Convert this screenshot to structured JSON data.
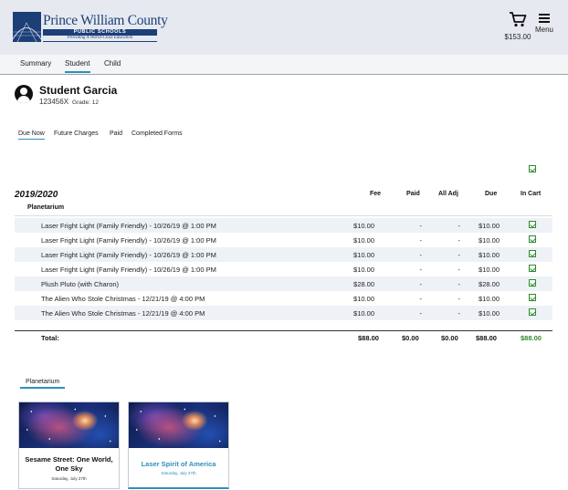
{
  "brand": {
    "name": "Prince William County",
    "band": "PUBLIC SCHOOLS",
    "tagline": "Providing A World-Class Education"
  },
  "header": {
    "cart_amount": "$153.00",
    "menu_label": "Menu"
  },
  "topnav": [
    "Summary",
    "Student",
    "Child"
  ],
  "topnav_active": "Student",
  "student": {
    "name": "Student Garcia",
    "id": "123456X",
    "grade": "Grade: 12"
  },
  "subtabs": [
    "Due Now",
    "Future Charges",
    "Paid",
    "Completed Forms"
  ],
  "subtabs_active": "Due Now",
  "table": {
    "year": "2019/2020",
    "columns": [
      "Fee",
      "Paid",
      "All Adj",
      "Due",
      "In Cart"
    ],
    "section": "Planetarium",
    "rows": [
      {
        "desc": "Laser Fright Light (Family Friendly) - 10/26/19 @ 1:00 PM",
        "fee": "$10.00",
        "paid": "-",
        "adj": "-",
        "due": "$10.00",
        "in_cart": true
      },
      {
        "desc": "Laser Fright Light (Family Friendly) - 10/26/19 @ 1:00 PM",
        "fee": "$10.00",
        "paid": "-",
        "adj": "-",
        "due": "$10.00",
        "in_cart": true
      },
      {
        "desc": "Laser Fright Light (Family Friendly) - 10/26/19 @ 1:00 PM",
        "fee": "$10.00",
        "paid": "-",
        "adj": "-",
        "due": "$10.00",
        "in_cart": true
      },
      {
        "desc": "Laser Fright Light (Family Friendly) - 10/26/19 @ 1:00 PM",
        "fee": "$10.00",
        "paid": "-",
        "adj": "-",
        "due": "$10.00",
        "in_cart": true
      },
      {
        "desc": "Plush Pluto (with Charon)",
        "fee": "$28.00",
        "paid": "-",
        "adj": "-",
        "due": "$28.00",
        "in_cart": true
      },
      {
        "desc": "The Alien Who Stole Christmas - 12/21/19 @ 4:00 PM",
        "fee": "$10.00",
        "paid": "-",
        "adj": "-",
        "due": "$10.00",
        "in_cart": true
      },
      {
        "desc": "The Alien Who Stole Christmas - 12/21/19 @ 4:00 PM",
        "fee": "$10.00",
        "paid": "-",
        "adj": "-",
        "due": "$10.00",
        "in_cart": true
      }
    ],
    "total": {
      "label": "Total:",
      "fee": "$88.00",
      "paid": "$0.00",
      "adj": "$0.00",
      "due": "$88.00",
      "in_cart": "$88.00"
    }
  },
  "activities": {
    "tab": "Planetarium",
    "cards": [
      {
        "title": "Sesame Street: One World, One Sky",
        "date": "Saturday, July 27th",
        "selected": false
      },
      {
        "title": "Laser Spirit of America",
        "date": "Saturday, July 27th",
        "selected": true
      }
    ]
  },
  "colors": {
    "brand_navy": "#1d3f78",
    "accent": "#2f8fb8",
    "cart_green": "#2e8b2e"
  },
  "icons": [
    "cart-icon",
    "hamburger-menu-icon",
    "user-avatar-icon",
    "checkbox-checked-icon"
  ]
}
